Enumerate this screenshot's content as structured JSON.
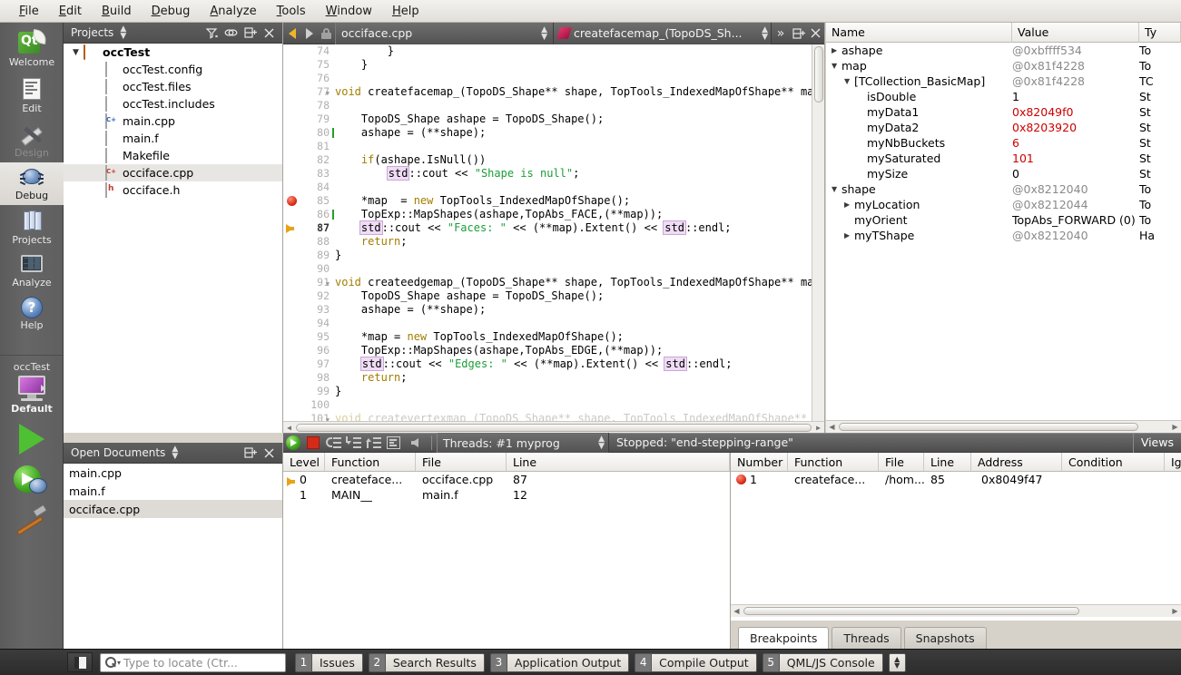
{
  "menu": {
    "items": [
      "File",
      "Edit",
      "Build",
      "Debug",
      "Analyze",
      "Tools",
      "Window",
      "Help"
    ]
  },
  "modebar": {
    "items": [
      {
        "label": "Welcome",
        "icon": "qt-logo-icon",
        "state": "normal"
      },
      {
        "label": "Edit",
        "icon": "document-icon",
        "state": "normal"
      },
      {
        "label": "Design",
        "icon": "design-icon",
        "state": "disabled"
      },
      {
        "label": "Debug",
        "icon": "bug-icon",
        "state": "active"
      },
      {
        "label": "Projects",
        "icon": "books-icon",
        "state": "normal"
      },
      {
        "label": "Analyze",
        "icon": "graph-icon",
        "state": "normal"
      },
      {
        "label": "Help",
        "icon": "question-icon",
        "state": "normal"
      }
    ],
    "kit_project": "occTest",
    "kit_config": "Default"
  },
  "projects_panel": {
    "title": "Projects",
    "tree": [
      {
        "label": "occTest",
        "indent": 0,
        "twisty": "▼",
        "icon": "folder-icon",
        "bold": true,
        "selected": false
      },
      {
        "label": "occTest.config",
        "indent": 1,
        "twisty": "",
        "icon": "file-icon",
        "bold": false,
        "selected": false
      },
      {
        "label": "occTest.files",
        "indent": 1,
        "twisty": "",
        "icon": "file-icon",
        "bold": false,
        "selected": false
      },
      {
        "label": "occTest.includes",
        "indent": 1,
        "twisty": "",
        "icon": "file-icon",
        "bold": false,
        "selected": false
      },
      {
        "label": "main.cpp",
        "indent": 1,
        "twisty": "",
        "icon": "cpp-file-icon",
        "bold": false,
        "selected": false
      },
      {
        "label": "main.f",
        "indent": 1,
        "twisty": "",
        "icon": "file-icon",
        "bold": false,
        "selected": false
      },
      {
        "label": "Makefile",
        "indent": 1,
        "twisty": "",
        "icon": "file-icon",
        "bold": false,
        "selected": false
      },
      {
        "label": "occiface.cpp",
        "indent": 1,
        "twisty": "",
        "icon": "cpp-file-red-icon",
        "bold": false,
        "selected": true
      },
      {
        "label": "occiface.h",
        "indent": 1,
        "twisty": "",
        "icon": "header-file-icon",
        "bold": false,
        "selected": false
      }
    ]
  },
  "open_documents": {
    "title": "Open Documents",
    "items": [
      {
        "label": "main.cpp",
        "selected": false
      },
      {
        "label": "main.f",
        "selected": false
      },
      {
        "label": "occiface.cpp",
        "selected": true
      }
    ]
  },
  "editor": {
    "file_combo": "occiface.cpp",
    "symbol_combo": "createfacemap_(TopoDS_Sh...",
    "overflow_label": "»",
    "lines": [
      {
        "n": 74,
        "text": "        }",
        "mark": "",
        "cursor_mark": false,
        "fold": false
      },
      {
        "n": 75,
        "text": "    }",
        "mark": "",
        "cursor_mark": false,
        "fold": false
      },
      {
        "n": 76,
        "text": "",
        "mark": "",
        "cursor_mark": false,
        "fold": false
      },
      {
        "n": 77,
        "text": "void createfacemap_(TopoDS_Shape** shape, TopTools_IndexedMapOfShape** ma",
        "mark": "",
        "cursor_mark": false,
        "fold": true
      },
      {
        "n": 78,
        "text": "",
        "mark": "",
        "cursor_mark": false,
        "fold": false
      },
      {
        "n": 79,
        "text": "    TopoDS_Shape ashape = TopoDS_Shape();",
        "mark": "",
        "cursor_mark": false,
        "fold": false
      },
      {
        "n": 80,
        "text": "    ashape = (**shape);",
        "mark": "",
        "cursor_mark": true,
        "fold": false
      },
      {
        "n": 81,
        "text": "",
        "mark": "",
        "cursor_mark": false,
        "fold": false
      },
      {
        "n": 82,
        "text": "    if(ashape.IsNull())",
        "mark": "",
        "cursor_mark": false,
        "fold": false
      },
      {
        "n": 83,
        "text": "        std::cout << \"Shape is null\";",
        "mark": "",
        "cursor_mark": false,
        "fold": false
      },
      {
        "n": 84,
        "text": "",
        "mark": "",
        "cursor_mark": false,
        "fold": false
      },
      {
        "n": 85,
        "text": "    *map  = new TopTools_IndexedMapOfShape();",
        "mark": "breakpoint",
        "cursor_mark": false,
        "fold": false
      },
      {
        "n": 86,
        "text": "    TopExp::MapShapes(ashape,TopAbs_FACE,(**map));",
        "mark": "",
        "cursor_mark": true,
        "fold": false
      },
      {
        "n": 87,
        "text": "    std::cout << \"Faces: \" << (**map).Extent() << std::endl;",
        "mark": "pc",
        "cursor_mark": false,
        "fold": false
      },
      {
        "n": 88,
        "text": "    return;",
        "mark": "",
        "cursor_mark": false,
        "fold": false
      },
      {
        "n": 89,
        "text": "}",
        "mark": "",
        "cursor_mark": false,
        "fold": false
      },
      {
        "n": 90,
        "text": "",
        "mark": "",
        "cursor_mark": false,
        "fold": false
      },
      {
        "n": 91,
        "text": "void createedgemap_(TopoDS_Shape** shape, TopTools_IndexedMapOfShape** ma",
        "mark": "",
        "cursor_mark": false,
        "fold": true
      },
      {
        "n": 92,
        "text": "    TopoDS_Shape ashape = TopoDS_Shape();",
        "mark": "",
        "cursor_mark": false,
        "fold": false
      },
      {
        "n": 93,
        "text": "    ashape = (**shape);",
        "mark": "",
        "cursor_mark": false,
        "fold": false
      },
      {
        "n": 94,
        "text": "",
        "mark": "",
        "cursor_mark": false,
        "fold": false
      },
      {
        "n": 95,
        "text": "    *map = new TopTools_IndexedMapOfShape();",
        "mark": "",
        "cursor_mark": false,
        "fold": false
      },
      {
        "n": 96,
        "text": "    TopExp::MapShapes(ashape,TopAbs_EDGE,(**map));",
        "mark": "",
        "cursor_mark": false,
        "fold": false
      },
      {
        "n": 97,
        "text": "    std::cout << \"Edges: \" << (**map).Extent() << std::endl;",
        "mark": "",
        "cursor_mark": false,
        "fold": false
      },
      {
        "n": 98,
        "text": "    return;",
        "mark": "",
        "cursor_mark": false,
        "fold": false
      },
      {
        "n": 99,
        "text": "}",
        "mark": "",
        "cursor_mark": false,
        "fold": false
      },
      {
        "n": 100,
        "text": "",
        "mark": "",
        "cursor_mark": false,
        "fold": false
      },
      {
        "n": 101,
        "text": "void createvertexmap_(TopoDS_Shape** shape, TopTools_IndexedMapOfShape**",
        "mark": "",
        "cursor_mark": false,
        "fold": true
      }
    ]
  },
  "locals": {
    "columns": [
      "Name",
      "Value",
      "Ty"
    ],
    "rows": [
      {
        "indent": 0,
        "twisty": "▶",
        "name": "ashape",
        "value": "@0xbffff534",
        "value_style": "ptr",
        "type": "To"
      },
      {
        "indent": 0,
        "twisty": "▼",
        "name": "map",
        "value": "@0x81f4228",
        "value_style": "ptr",
        "type": "To"
      },
      {
        "indent": 1,
        "twisty": "▼",
        "name": "[TCollection_BasicMap]",
        "value": "@0x81f4228",
        "value_style": "ptr",
        "type": "TC"
      },
      {
        "indent": 2,
        "twisty": "",
        "name": "isDouble",
        "value": "1",
        "value_style": "normal",
        "type": "St"
      },
      {
        "indent": 2,
        "twisty": "",
        "name": "myData1",
        "value": "0x82049f0",
        "value_style": "red",
        "type": "St"
      },
      {
        "indent": 2,
        "twisty": "",
        "name": "myData2",
        "value": "0x8203920",
        "value_style": "red",
        "type": "St"
      },
      {
        "indent": 2,
        "twisty": "",
        "name": "myNbBuckets",
        "value": "6",
        "value_style": "red",
        "type": "St"
      },
      {
        "indent": 2,
        "twisty": "",
        "name": "mySaturated",
        "value": "101",
        "value_style": "red",
        "type": "St"
      },
      {
        "indent": 2,
        "twisty": "",
        "name": "mySize",
        "value": "0",
        "value_style": "normal",
        "type": "St"
      },
      {
        "indent": 0,
        "twisty": "▼",
        "name": "shape",
        "value": "@0x8212040",
        "value_style": "ptr",
        "type": "To"
      },
      {
        "indent": 1,
        "twisty": "▶",
        "name": "myLocation",
        "value": "@0x8212044",
        "value_style": "ptr",
        "type": "To"
      },
      {
        "indent": 1,
        "twisty": "",
        "name": "myOrient",
        "value": "TopAbs_FORWARD (0)",
        "value_style": "normal",
        "type": "To"
      },
      {
        "indent": 1,
        "twisty": "▶",
        "name": "myTShape",
        "value": "@0x8212040",
        "value_style": "ptr",
        "type": "Ha"
      }
    ]
  },
  "debug_toolbar": {
    "buttons": [
      "continue-icon",
      "stop-icon",
      "step-over-icon",
      "step-into-icon",
      "step-out-icon",
      "instruction-view-icon",
      "return-icon"
    ],
    "threads_label": "Threads: #1 myprog",
    "status": "Stopped: \"end-stepping-range\"",
    "views_label": "Views"
  },
  "stack_pane": {
    "columns": [
      "Level",
      "Function",
      "File",
      "Line"
    ],
    "rows": [
      {
        "level": "0",
        "function": "createface...",
        "file": "occiface.cpp",
        "line": "87",
        "current": true
      },
      {
        "level": "1",
        "function": "MAIN__",
        "file": "main.f",
        "line": "12",
        "current": false
      }
    ]
  },
  "breakpoints_pane": {
    "columns": [
      "Number",
      "Function",
      "File",
      "Line",
      "Address",
      "Condition",
      "Ig"
    ],
    "rows": [
      {
        "number": "1",
        "function": "createface...",
        "file": "/hom...",
        "line": "85",
        "address": "0x8049f47",
        "condition": "",
        "enabled": true
      }
    ],
    "tabs": [
      {
        "label": "Breakpoints",
        "active": true
      },
      {
        "label": "Threads",
        "active": false
      },
      {
        "label": "Snapshots",
        "active": false
      }
    ]
  },
  "statusbar": {
    "locate_placeholder": "Type to locate (Ctr...",
    "output_tabs": [
      {
        "num": "1",
        "label": "Issues"
      },
      {
        "num": "2",
        "label": "Search Results"
      },
      {
        "num": "3",
        "label": "Application Output"
      },
      {
        "num": "4",
        "label": "Compile Output"
      },
      {
        "num": "5",
        "label": "QML/JS Console"
      }
    ]
  }
}
